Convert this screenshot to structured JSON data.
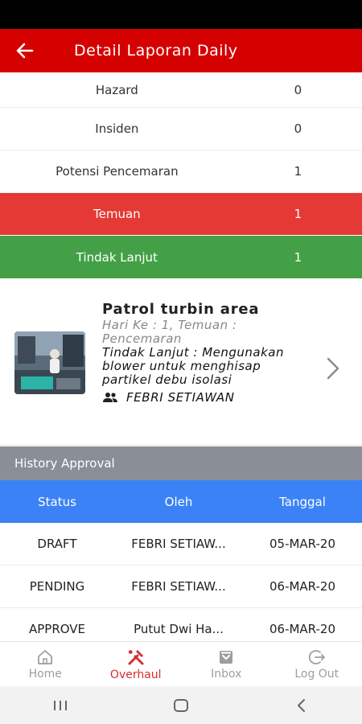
{
  "app_bar": {
    "title": "Detail Laporan Daily"
  },
  "summary": [
    {
      "label": "Hazard",
      "value": "0"
    },
    {
      "label": "Insiden",
      "value": "0"
    },
    {
      "label": "Potensi Pencemaran",
      "value": "1"
    },
    {
      "label": "Temuan",
      "value": "1"
    },
    {
      "label": "Tindak Lanjut",
      "value": "1"
    }
  ],
  "card": {
    "title": "Patrol turbin area",
    "subtitle": "Hari Ke : 1, Temuan : Pencemaran",
    "follow_up": "Tindak Lanjut : Mengunakan blower untuk menghisap partikel debu isolasi",
    "user": "FEBRI SETIAWAN",
    "user_icon": "people-icon"
  },
  "history": {
    "title": "History Approval",
    "columns": [
      "Status",
      "Oleh",
      "Tanggal"
    ],
    "rows": [
      {
        "status": "DRAFT",
        "by": "FEBRI SETIAW...",
        "date": "05-MAR-20"
      },
      {
        "status": "PENDING",
        "by": "FEBRI SETIAW...",
        "date": "06-MAR-20"
      },
      {
        "status": "APPROVE",
        "by": "Putut Dwi Ha...",
        "date": "06-MAR-20"
      }
    ]
  },
  "bottom_nav": [
    {
      "label": "Home",
      "icon": "home-icon"
    },
    {
      "label": "Overhaul",
      "icon": "tools-icon",
      "active": true
    },
    {
      "label": "Inbox",
      "icon": "inbox-icon"
    },
    {
      "label": "Log Out",
      "icon": "logout-icon"
    }
  ],
  "colors": {
    "primary": "#d50000",
    "temuan": "#e53935",
    "tindak_lanjut": "#43a047",
    "history_header": "#8a8f97",
    "table_header": "#3b82f6"
  }
}
